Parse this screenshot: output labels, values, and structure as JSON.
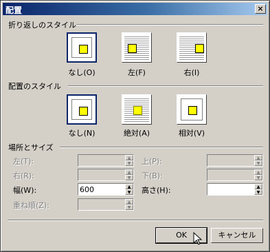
{
  "window": {
    "title": "配置",
    "close_glyph": "×"
  },
  "wrap": {
    "section": "折り返しのスタイル",
    "options": [
      {
        "label": "なし(O)",
        "selected": true
      },
      {
        "label": "左(F)",
        "selected": false
      },
      {
        "label": "右(I)",
        "selected": false
      }
    ]
  },
  "placement": {
    "section": "配置のスタイル",
    "options": [
      {
        "label": "なし(N)",
        "selected": true
      },
      {
        "label": "絶対(A)",
        "selected": false
      },
      {
        "label": "相対(V)",
        "selected": false
      }
    ]
  },
  "position": {
    "section": "場所とサイズ",
    "fields": {
      "left": {
        "label": "左(T):",
        "value": "",
        "enabled": false
      },
      "top": {
        "label": "上(P):",
        "value": "",
        "enabled": false
      },
      "right": {
        "label": "右(R):",
        "value": "",
        "enabled": false
      },
      "bottom": {
        "label": "下(B):",
        "value": "",
        "enabled": false
      },
      "width": {
        "label": "幅(W):",
        "value": "600",
        "enabled": true
      },
      "height": {
        "label": "高さ(H):",
        "value": "",
        "enabled": true
      },
      "zorder": {
        "label": "重ね順(Z):",
        "value": "",
        "enabled": false
      }
    }
  },
  "buttons": {
    "ok": "OK",
    "cancel": "キャンセル"
  },
  "icons": {
    "spin_up": "▲",
    "spin_down": "▼",
    "cursor": "arrow-cursor"
  }
}
